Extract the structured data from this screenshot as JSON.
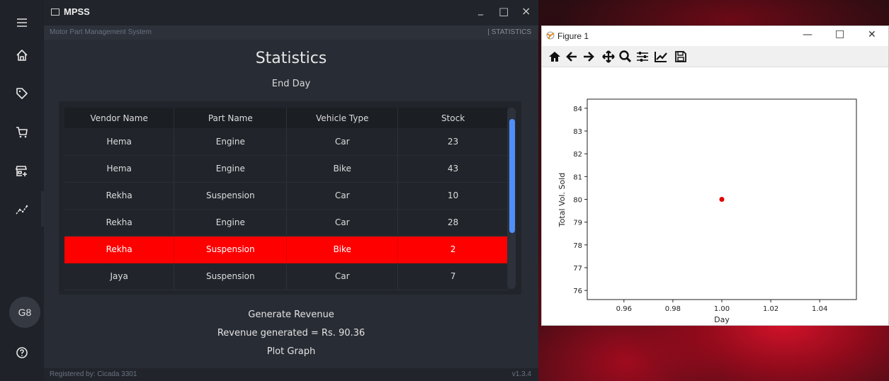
{
  "app": {
    "title": "MPSS",
    "subtitle": "Motor Part Management System",
    "section_tag": "| STATISTICS",
    "window_controls": {
      "minimize": "_",
      "maximize": "□",
      "close": "×"
    }
  },
  "sidebar": {
    "items": [
      {
        "name": "menu-icon"
      },
      {
        "name": "home-icon"
      },
      {
        "name": "tag-icon"
      },
      {
        "name": "cart-icon"
      },
      {
        "name": "store-add-icon"
      },
      {
        "name": "chart-icon",
        "active": true
      }
    ],
    "avatar": "G8",
    "help_icon": "help-icon"
  },
  "main": {
    "title": "Statistics",
    "subtitle": "End Day",
    "table": {
      "headers": [
        "Vendor Name",
        "Part Name",
        "Vehicle Type",
        "Stock"
      ],
      "rows": [
        {
          "vendor": "Hema",
          "part": "Engine",
          "vehicle": "Car",
          "stock": "23"
        },
        {
          "vendor": "Hema",
          "part": "Engine",
          "vehicle": "Bike",
          "stock": "43"
        },
        {
          "vendor": "Rekha",
          "part": "Suspension",
          "vehicle": "Car",
          "stock": "10"
        },
        {
          "vendor": "Rekha",
          "part": "Engine",
          "vehicle": "Car",
          "stock": "28"
        },
        {
          "vendor": "Rekha",
          "part": "Suspension",
          "vehicle": "Bike",
          "stock": "2",
          "highlight": true
        },
        {
          "vendor": "Jaya",
          "part": "Suspension",
          "vehicle": "Car",
          "stock": "7"
        }
      ],
      "highlight_color": "#ff0000",
      "scrollbar_color": "#4f8ff7"
    },
    "generate_label": "Generate Revenue",
    "revenue_text": "Revenue generated = Rs. 90.36",
    "plot_label": "Plot Graph"
  },
  "footer": {
    "registered": "Registered by: Cicada 3301",
    "version": "v1.3.4"
  },
  "figure": {
    "title": "Figure 1",
    "controls": {
      "minimize": "—",
      "maximize": "□",
      "close": "✕"
    },
    "toolbar": [
      "home-icon",
      "back-icon",
      "forward-icon",
      "pan-icon",
      "zoom-icon",
      "configure-icon",
      "edit-axis-icon",
      "save-icon"
    ]
  },
  "chart_data": {
    "type": "scatter",
    "x": [
      1.0
    ],
    "y": [
      80
    ],
    "xlabel": "Day",
    "ylabel": "Total Vol. Sold",
    "xlim": [
      0.945,
      1.055
    ],
    "ylim": [
      75.6,
      84.4
    ],
    "xticks": [
      "0.96",
      "0.98",
      "1.00",
      "1.02",
      "1.04"
    ],
    "yticks": [
      "76",
      "77",
      "78",
      "79",
      "80",
      "81",
      "82",
      "83",
      "84"
    ],
    "marker_color": "#e00000",
    "grid": false
  }
}
